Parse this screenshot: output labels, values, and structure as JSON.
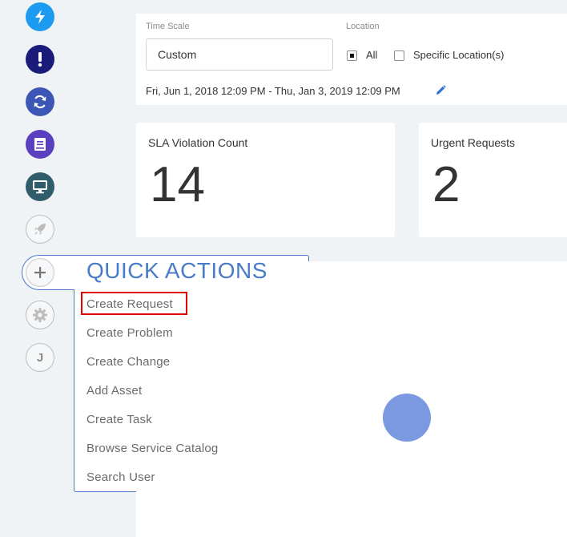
{
  "sidebar": {
    "icons": [
      {
        "name": "lightning-icon",
        "color": "#1d9bf0"
      },
      {
        "name": "exclamation-icon",
        "color": "#1b1b7a"
      },
      {
        "name": "refresh-icon",
        "color": "#3b56b5"
      },
      {
        "name": "book-icon",
        "color": "#5a3fbf"
      },
      {
        "name": "monitor-icon",
        "color": "#2f5d69"
      },
      {
        "name": "rocket-icon",
        "color": "#bdbdbd"
      },
      {
        "name": "plus-icon",
        "color": "#4a7bc8"
      },
      {
        "name": "gear-icon",
        "color": "#bdbdbd"
      }
    ],
    "avatar_initial": "J"
  },
  "filters": {
    "time_scale_label": "Time Scale",
    "time_scale_value": "Custom",
    "location_label": "Location",
    "location_all_label": "All",
    "location_all_checked": true,
    "location_specific_label": "Specific Location(s)",
    "location_specific_checked": false,
    "date_range": "Fri, Jun 1, 2018 12:09 PM - Thu, Jan 3, 2019 12:09 PM"
  },
  "kpis": [
    {
      "title": "SLA Violation Count",
      "value": "14"
    },
    {
      "title": "Urgent Requests",
      "value": "2"
    }
  ],
  "quick_actions": {
    "title": "QUICK ACTIONS",
    "items": [
      "Create Request",
      "Create Problem",
      "Create Change",
      "Add Asset",
      "Create Task",
      "Browse Service Catalog",
      "Search User"
    ]
  },
  "colors": {
    "accent": "#4a7bc8",
    "highlight": "#e00000",
    "spinner": "#7b99e1"
  }
}
